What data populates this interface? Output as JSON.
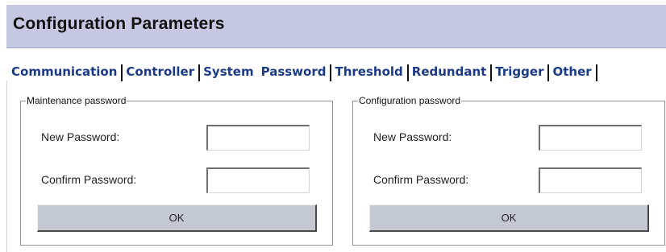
{
  "header": {
    "title": "Configuration Parameters"
  },
  "tabs": [
    {
      "label": "Communication",
      "active": false
    },
    {
      "label": "Controller",
      "active": false
    },
    {
      "label": "System",
      "active": false
    },
    {
      "label": "Password",
      "active": true
    },
    {
      "label": "Threshold",
      "active": false
    },
    {
      "label": "Redundant",
      "active": false
    },
    {
      "label": "Trigger",
      "active": false
    },
    {
      "label": "Other",
      "active": false
    }
  ],
  "maintenance": {
    "legend": "Maintenance password",
    "new_label": "New Password:",
    "new_value": "",
    "confirm_label": "Confirm Password:",
    "confirm_value": "",
    "ok_label": "OK"
  },
  "configuration": {
    "legend": "Configuration password",
    "new_label": "New Password:",
    "new_value": "",
    "confirm_label": "Confirm Password:",
    "confirm_value": "",
    "ok_label": "OK"
  },
  "colors": {
    "header_bg": "#c5c7e3",
    "tab_text": "#1a3a84",
    "button_bg": "#c4c9d0"
  }
}
